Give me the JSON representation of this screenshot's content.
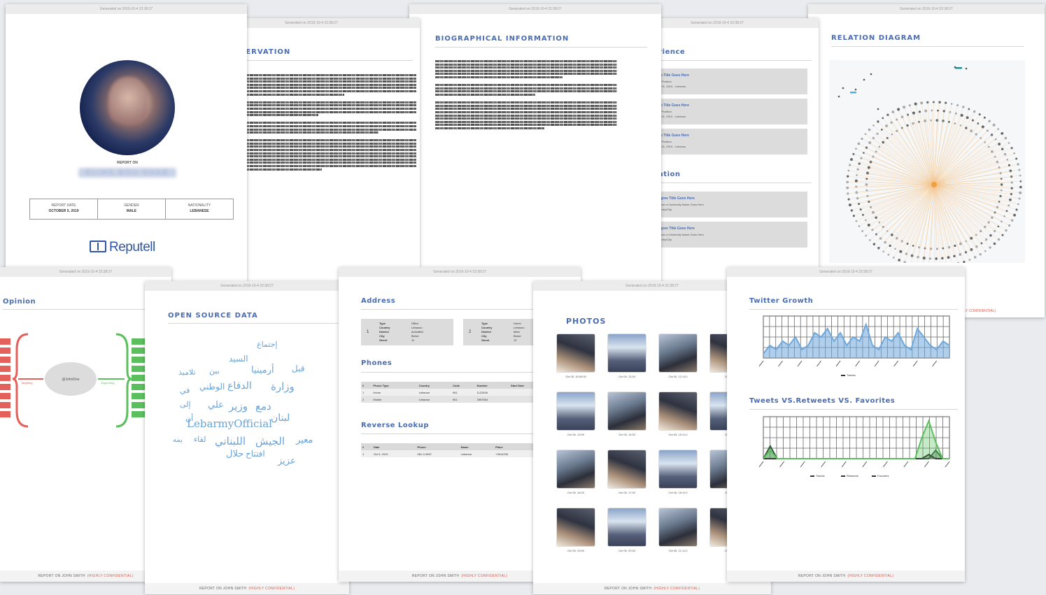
{
  "footer": {
    "report_label": "REPORT ON JOHN SMITH",
    "confidential": "(HIGHLY CONFIDENTIAL)"
  },
  "cover": {
    "generated": "Generated on 2019-10-4 22:38:27",
    "report_on": "REPORT ON",
    "name": "ELIAS BOU SAAB",
    "fields": [
      {
        "label": "REPORT DATE",
        "value": "OCTOBER 5, 2019"
      },
      {
        "label": "GENDER",
        "value": "MALE"
      },
      {
        "label": "NATIONALITY",
        "value": "LEBANESE"
      }
    ],
    "brand": "Reputell"
  },
  "observation": {
    "generated": "Generated on 2019-10-4 22:38:27",
    "title": "OBSERVATION"
  },
  "bio": {
    "generated": "Generated on 2019-10-4 22:38:27",
    "title": "BIOGRAPHICAL INFORMATION"
  },
  "experience": {
    "generated": "Generated on 2019-10-4 22:38:27",
    "title": "Experience",
    "items": [
      {
        "num": "1",
        "title": "Job Title Goes Here",
        "sub": "Job Position",
        "date": "Jan 01, 2019 - Lebanon"
      },
      {
        "num": "2",
        "title": "Job Title Goes Here",
        "sub": "Job Position",
        "date": "Jan 01, 2019 - Lebanon"
      },
      {
        "num": "3",
        "title": "Job Title Goes Here",
        "sub": "Job Position",
        "date": "Jan 01, 2019 - Lebanon"
      }
    ],
    "edu_title": "Education",
    "edu_items": [
      {
        "num": "1",
        "title": "Degree Title Goes Here",
        "sub": "School or University Name Goes Here",
        "date": "Country/City"
      },
      {
        "num": "2",
        "title": "Degree Title Goes Here",
        "sub": "School or University Name Goes Here",
        "date": "Country/City"
      }
    ]
  },
  "relation": {
    "generated": "Generated on 2019-10-4 22:38:27",
    "title": "RELATION DIAGRAM"
  },
  "opinion": {
    "generated": "Generated on 2019-10-4 22:38:27",
    "title": "Opinion",
    "center": "@JohnDoe",
    "left_label": "Targeting",
    "right_label": "Supporting"
  },
  "osd": {
    "generated": "Generated on 2019-10-4 22:38:27",
    "title": "OPEN SOURCE DATA",
    "words": [
      "إجتماع",
      "السيد",
      "أرمينيا",
      "قبل",
      "بين",
      "تلاميذ",
      "وزارة",
      "الدفاع",
      "الوطني",
      "في",
      "وزير",
      "علي",
      "إلى",
      "دمع",
      "لبنان",
      "LebarmyOfficial",
      "أن",
      "معير",
      "الجيش",
      "اللبناني",
      "لقاء",
      "حلال",
      "افتتاح",
      "عزيز",
      "يمه"
    ]
  },
  "address": {
    "generated": "Generated on 2019-10-4 22:38:27",
    "title": "Address",
    "cards": [
      {
        "num": "1",
        "keys": [
          "Type",
          "Country",
          "District",
          "City",
          "Street"
        ],
        "vals": [
          "Office",
          "Lebanon",
          "Achrafieh",
          "Beirut",
          "11"
        ]
      },
      {
        "num": "2",
        "keys": [
          "Type",
          "Country",
          "District",
          "City",
          "Street"
        ],
        "vals": [
          "Home",
          "Lebanon",
          "Metn",
          "Beirut",
          "12"
        ]
      }
    ],
    "phones_title": "Phones",
    "phones_head": [
      "#",
      "Phone Type",
      "Country",
      "Code",
      "Number",
      "Start Date",
      "To"
    ],
    "phones_rows": [
      [
        "1",
        "Home",
        "Lebanon",
        "961",
        "1123456",
        "",
        ""
      ],
      [
        "2",
        "Mobile",
        "Lebanon",
        "961",
        "3987654",
        "",
        ""
      ]
    ],
    "reverse_title": "Reverse Lookup",
    "reverse_head": [
      "#",
      "Date",
      "Phone",
      "Name",
      "Place",
      "Off Dat"
    ],
    "reverse_rows": [
      [
        "1",
        "Oct 5, 2019",
        "961-3-4567",
        "Lebanon",
        "+9614230",
        "Beirut"
      ]
    ]
  },
  "photos": {
    "generated": "Generated on 2019-10-4 22:38:27",
    "title": "PHOTOS",
    "captions": [
      "Oct 05, 15:00:00",
      "Oct 05, 12:00",
      "Oct 05, 12:11:0",
      "Oct 15",
      "Oct 05, 13:00",
      "Oct 05, 14:00",
      "Oct 05, 15:11:0",
      "Oct 15",
      "Oct 05, 16:00",
      "Oct 05, 17:00",
      "Oct 05, 18:11:0",
      "Oct 15",
      "Oct 05, 19:00",
      "Oct 05, 20:00",
      "Oct 05, 21:11:0",
      "Oct 15"
    ]
  },
  "twitter": {
    "generated": "Generated on 2019-10-4 22:38:27",
    "title": "Twitter Growth",
    "title2": "Tweets VS.Retweets VS. Favorites",
    "legend1": [
      "Tweets"
    ],
    "legend2": [
      "Tweets",
      "Retweets",
      "Favorites"
    ]
  },
  "chart_data": [
    {
      "type": "area",
      "title": "Twitter Growth",
      "series": [
        {
          "name": "Tweets",
          "values": [
            1,
            3,
            2,
            4,
            3,
            5,
            2,
            3,
            6,
            5,
            7,
            4,
            6,
            3,
            5,
            4,
            8,
            3,
            2,
            5,
            4,
            6,
            3,
            2,
            7,
            5,
            3,
            2,
            4,
            3
          ]
        }
      ],
      "ylim": [
        0,
        10
      ]
    },
    {
      "type": "line",
      "title": "Tweets VS.Retweets VS. Favorites",
      "series": [
        {
          "name": "Tweets",
          "values": [
            0,
            3,
            0,
            0,
            0,
            0,
            0,
            0,
            0,
            0,
            0,
            0,
            0,
            0,
            0,
            0,
            0,
            0,
            0,
            0,
            0,
            0,
            0,
            0,
            0,
            2,
            0,
            0
          ]
        },
        {
          "name": "Retweets",
          "values": [
            0,
            0,
            0,
            0,
            0,
            0,
            0,
            0,
            0,
            0,
            0,
            0,
            0,
            0,
            0,
            0,
            0,
            0,
            0,
            0,
            0,
            0,
            0,
            0,
            1,
            0,
            0,
            0
          ]
        },
        {
          "name": "Favorites",
          "values": [
            0,
            2,
            0,
            0,
            0,
            0,
            0,
            0,
            0,
            0,
            0,
            0,
            0,
            0,
            0,
            0,
            0,
            0,
            0,
            0,
            0,
            0,
            0,
            5,
            9,
            4,
            0,
            0
          ]
        }
      ],
      "ylim": [
        0,
        10
      ]
    }
  ],
  "colors": {
    "accent": "#4a6cb0",
    "confidential": "#e05a4f",
    "area": "#6ea8dc",
    "green": "#5cbf5e",
    "red": "#e4605a",
    "orange": "#f0a040"
  }
}
